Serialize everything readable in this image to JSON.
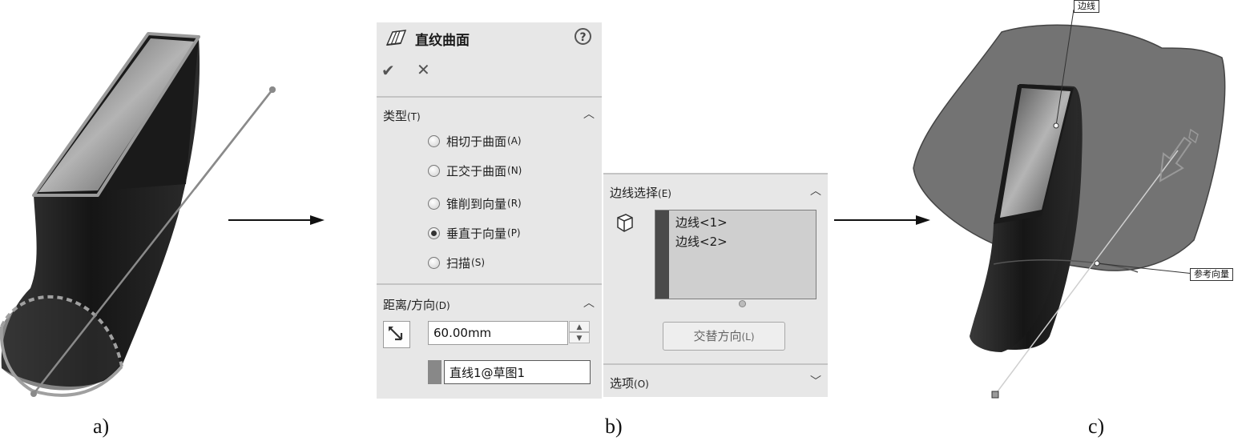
{
  "captions": {
    "a": "a)",
    "b": "b)",
    "c": "c)"
  },
  "ruled_surface_panel": {
    "title": "直纹曲面",
    "help_icon": "question-circle-icon",
    "ok_icon": "checkmark-icon",
    "cancel_icon": "x-icon",
    "type_section": {
      "label": "类型",
      "hotkey": "(T)",
      "options": [
        {
          "label": "相切于曲面",
          "hotkey": "(A)",
          "selected": false
        },
        {
          "label": "正交于曲面",
          "hotkey": "(N)",
          "selected": false
        },
        {
          "label": "锥削到向量",
          "hotkey": "(R)",
          "selected": false
        },
        {
          "label": "垂直于向量",
          "hotkey": "(P)",
          "selected": true
        },
        {
          "label": "扫描",
          "hotkey": "(S)",
          "selected": false
        }
      ]
    },
    "distance_section": {
      "label": "距离/方向",
      "hotkey": "(D)",
      "distance_value": "60.00mm",
      "reference_line": "直线1@草图1"
    }
  },
  "edge_panel": {
    "section_label": "边线选择",
    "section_hotkey": "(E)",
    "edges": [
      "边线<1>",
      "边线<2>"
    ],
    "flip_button_label": "交替方向",
    "flip_button_hotkey": "(L)",
    "options_label": "选项",
    "options_hotkey": "(O)"
  },
  "callouts": {
    "edge": "边线",
    "reference_vector": "参考向量"
  },
  "colors": {
    "panel_bg": "#e7e7e7",
    "body_dark": "#1e1e1e",
    "surface_gray": "#6e6e6e"
  }
}
